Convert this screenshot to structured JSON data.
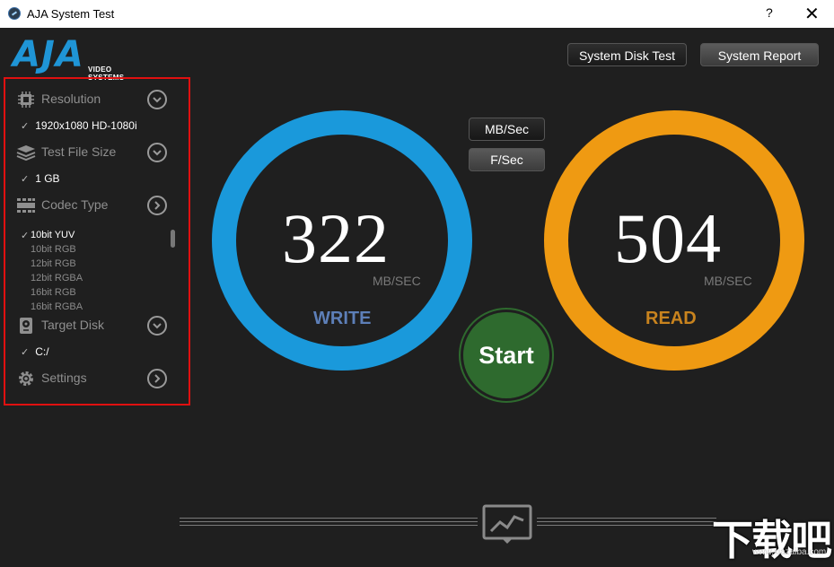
{
  "window": {
    "title": "AJA System Test",
    "help": "?",
    "close": "✕"
  },
  "logo": {
    "letters": "AJA",
    "tagline": "VIDEO SYSTEMS"
  },
  "toolbar": {
    "disk_test": "System Disk Test",
    "report": "System Report"
  },
  "sidebar": {
    "resolution": {
      "label": "Resolution",
      "value": "1920x1080 HD-1080i"
    },
    "file_size": {
      "label": "Test File Size",
      "value": "1 GB"
    },
    "codec": {
      "label": "Codec Type",
      "items": [
        "10bit YUV",
        "10bit RGB",
        "12bit RGB",
        "12bit RGBA",
        "16bit RGB",
        "16bit RGBA"
      ],
      "selected": "10bit YUV"
    },
    "target_disk": {
      "label": "Target Disk",
      "value": "C:/"
    },
    "settings": {
      "label": "Settings"
    },
    "check": "✓"
  },
  "units": {
    "mb_sec": "MB/Sec",
    "f_sec": "F/Sec"
  },
  "write": {
    "value": "322",
    "unit": "MB/SEC",
    "label": "WRITE",
    "color": "#1a99db",
    "label_color": "#5d7fb8"
  },
  "read": {
    "value": "504",
    "unit": "MB/SEC",
    "label": "READ",
    "color": "#ef9a12",
    "label_color": "#c8831e"
  },
  "start": {
    "label": "Start"
  },
  "watermark": {
    "text": "下载吧",
    "url": "www.xiazaiba.com"
  }
}
